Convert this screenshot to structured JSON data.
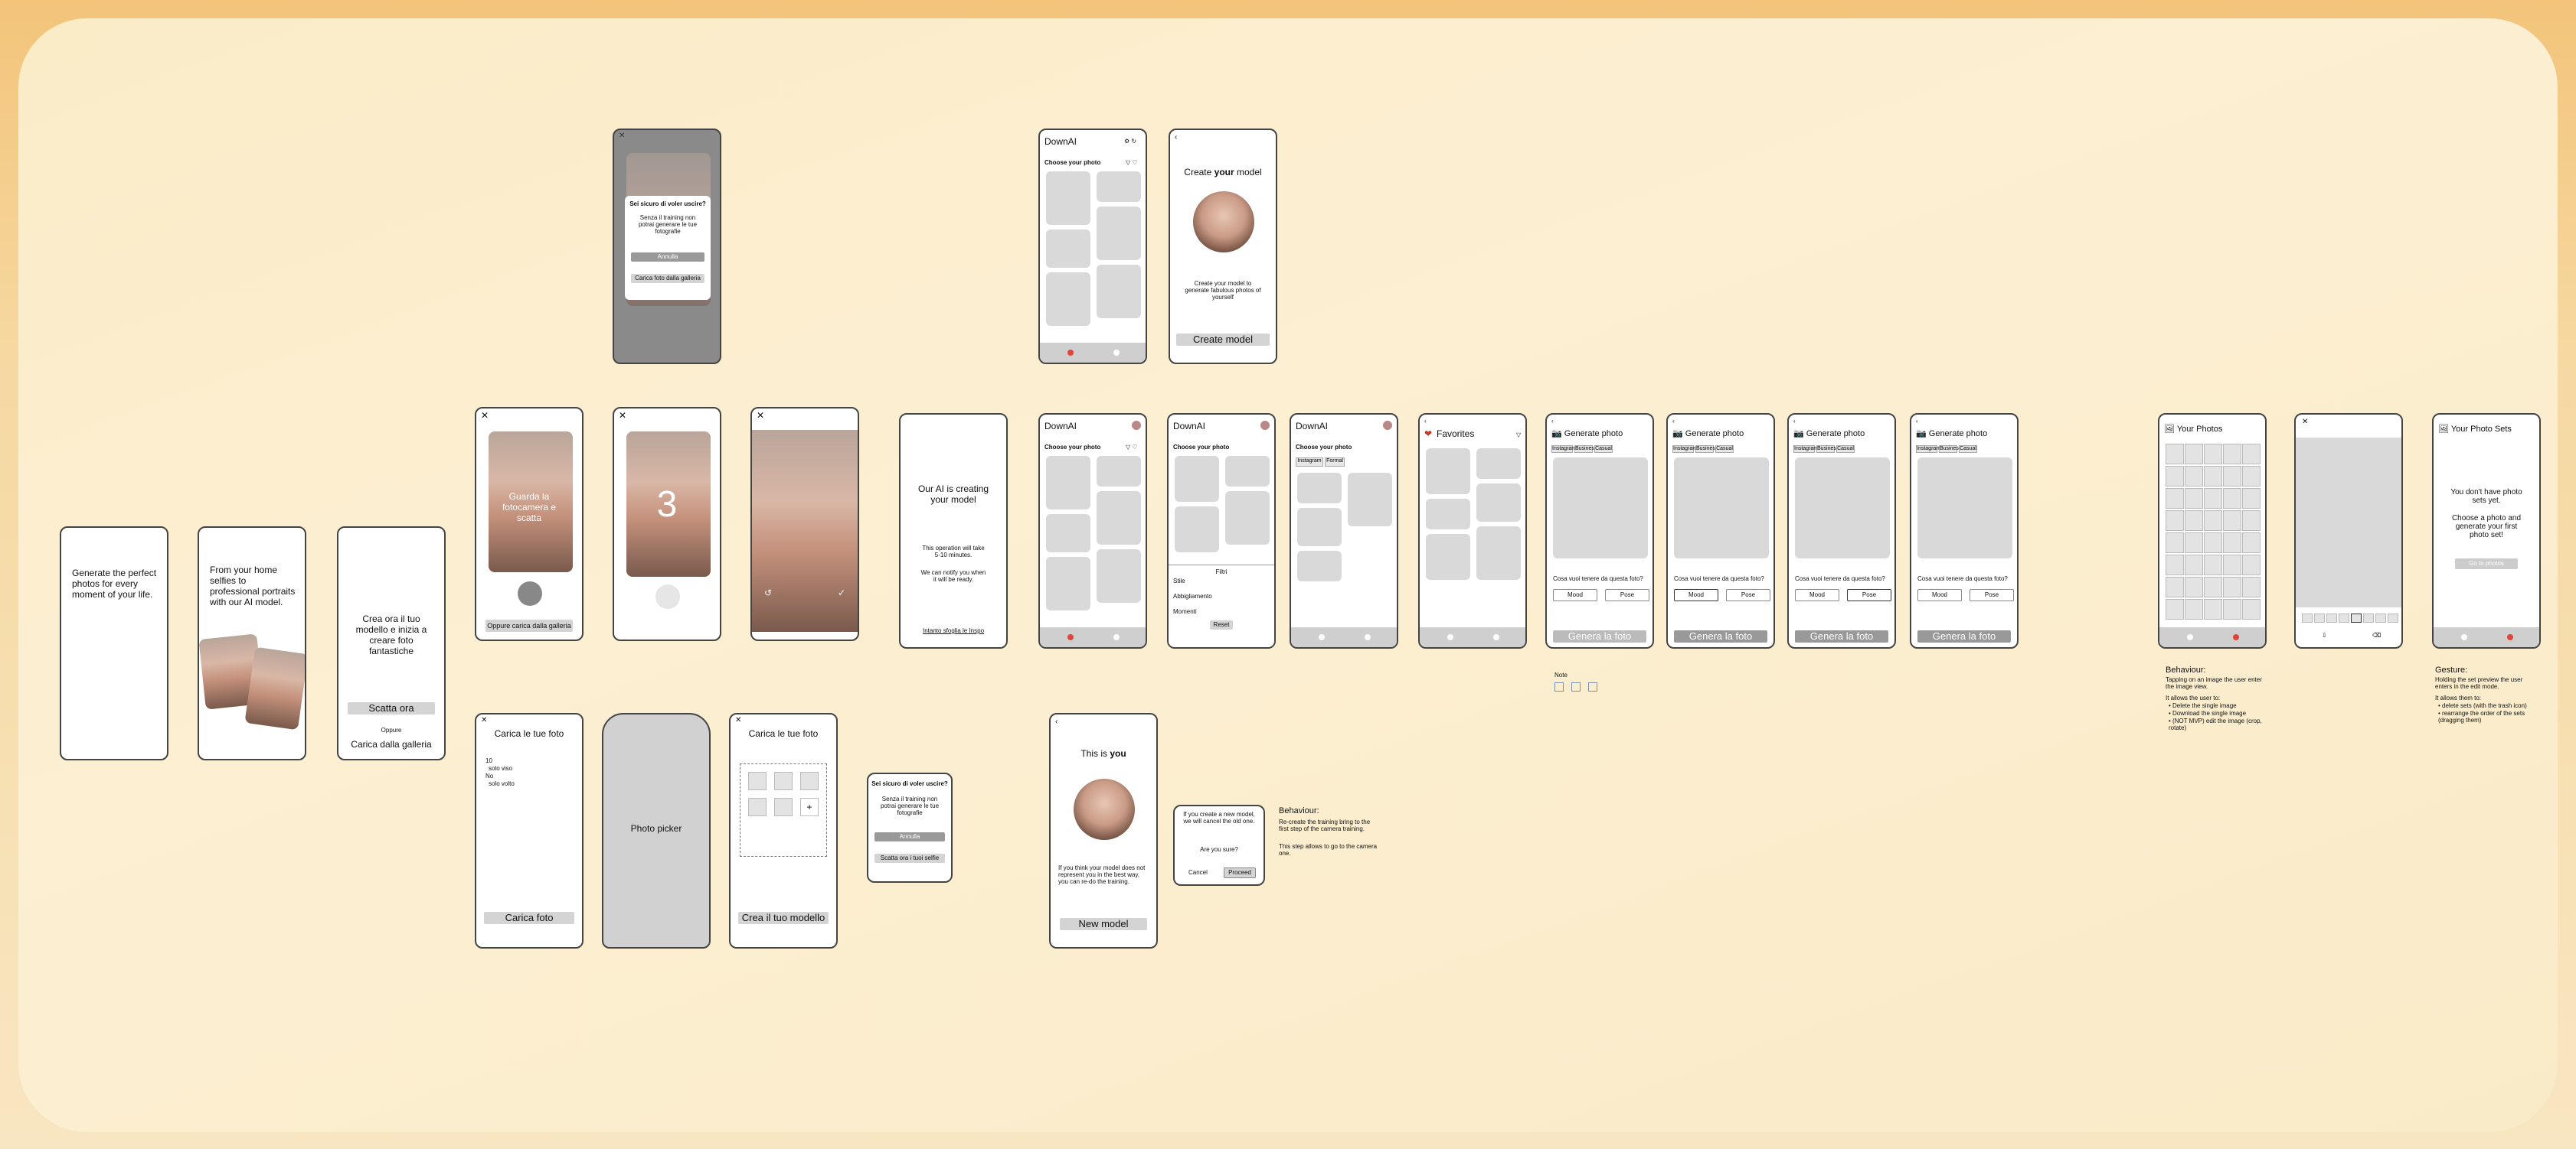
{
  "onboarding": {
    "s1": "Generate the perfect photos for every moment of your life.",
    "s2": "From your home selfies to professional portraits with our AI model.",
    "s3": "Crea ora il tuo modello e inizia a creare foto fantastiche",
    "s3_btn": "Scatta ora",
    "s3_or": "Oppure",
    "s3_link": "Carica dalla galleria"
  },
  "camera": {
    "overlay": "Guarda la fotocamera e scatta",
    "gallery_btn": "Oppure carica dalla galleria",
    "countdown": "3"
  },
  "confirm": {
    "title": "Sei sicuro di voler uscire?",
    "body": "Senza il training non potrai generare le tue fotografie",
    "cancel": "Annulla",
    "gallery": "Carica foto dalla galleria",
    "selfie": "Scatta ora i tuoi selfie"
  },
  "upload": {
    "title": "Carica le tue foto",
    "note1": "10",
    "note2": "solo viso",
    "note3": "No",
    "note4": "solo volto",
    "btn": "Carica foto",
    "picker": "Photo picker",
    "create_btn": "Crea il tuo modello"
  },
  "ai": {
    "title": "Our AI is creating your model",
    "body1": "This operation will take 5-10 minutes.",
    "body2": "We can notify you when it will be ready.",
    "link": "Intanto sfoglia le Inspo"
  },
  "home": {
    "app": "DownAI",
    "subtitle": "Choose your photo",
    "filter1": "Instagram",
    "filter2": "Formal",
    "favorites": "Favorites"
  },
  "create_model": {
    "title_pre": "Create ",
    "title_bold": "your",
    "title_post": " model",
    "desc": "Create your model to generate fabulous photos of yourself",
    "btn": "Create model"
  },
  "this_is_you": {
    "title_pre": "This is ",
    "title_bold": "you",
    "desc": "If you think your model does not represent you in the best way, you can re-do the training.",
    "btn": "New model"
  },
  "new_model_dialog": {
    "body": "If you create a new model, we will cancel the old one.",
    "question": "Are you sure?",
    "cancel": "Cancel",
    "proceed": "Proceed"
  },
  "behaviour_training": {
    "title": "Behaviour:",
    "l1": "Re-create the training bring to the first step of the camera training.",
    "l2": "This step allows to go to the camera one."
  },
  "filters_sheet": {
    "title": "Filtri",
    "c1": "Stile",
    "a": "Abbigliamento",
    "b": "Momenti",
    "btn": "Reset"
  },
  "generate": {
    "title": "Generate photo",
    "question": "Cosa vuoi tenere da questa foto?",
    "mood": "Mood",
    "pose": "Pose",
    "btn": "Genera la foto",
    "tags": [
      "Instagram",
      "Business",
      "Casual"
    ],
    "note_label": "Note"
  },
  "photos": {
    "title": "Your Photos",
    "behaviour_title": "Behaviour:",
    "behaviour_lines": [
      "Tapping on an image the user enter the image view.",
      "It allows the user to:",
      "• Delete the single image",
      "• Download the single image",
      "• (NOT MVP) edit the image (crop, rotate)"
    ]
  },
  "photo_sets": {
    "title": "Your Photo Sets",
    "l1": "You don't have photo sets yet.",
    "l2": "Choose a photo and generate your first photo set!",
    "btn": "Go to photos",
    "gesture_title": "Gesture:",
    "gesture_lines": [
      "Holding the set preview the user enters in the edit mode.",
      "It allows them to:",
      "• delete sets (with the trash icon)",
      "• rearrange the order of the sets (dragging them)"
    ]
  },
  "colors": {
    "accent": "#e0443a",
    "frame": "#444444",
    "placeholder": "#d9d9d9"
  }
}
